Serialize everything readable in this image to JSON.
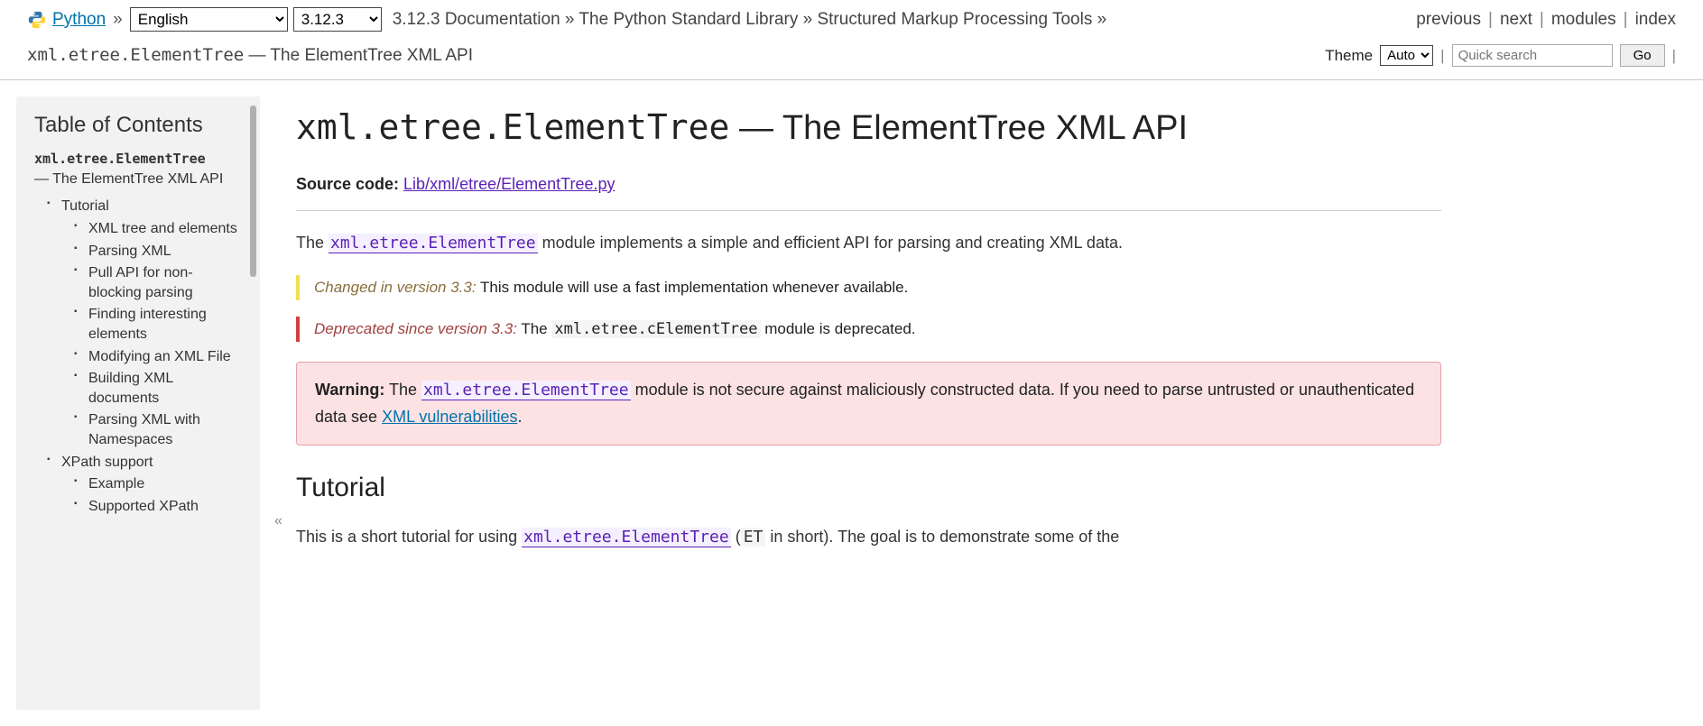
{
  "topbar": {
    "python": "Python",
    "lang": "English",
    "version": "3.12.3",
    "crumb1": "3.12.3 Documentation",
    "crumb2": "The Python Standard Library",
    "crumb3": "Structured Markup Processing Tools",
    "prev": "previous",
    "next": "next",
    "modules": "modules",
    "index": "index"
  },
  "subbar": {
    "mono": "xml.etree.ElementTree",
    "rest": " — The ElementTree XML API",
    "theme_label": "Theme",
    "theme_value": "Auto",
    "search_placeholder": "Quick search",
    "go": "Go"
  },
  "toc": {
    "title": "Table of Contents",
    "root_mono": "xml.etree.ElementTree",
    "root_rest": "— The ElementTree XML API",
    "items": {
      "tutorial": "Tutorial",
      "xmltree": "XML tree and elements",
      "parsing": "Parsing XML",
      "pullapi": "Pull API for non-blocking parsing",
      "finding": "Finding interesting elements",
      "modifying": "Modifying an XML File",
      "building": "Building XML documents",
      "namespaces": "Parsing XML with Namespaces",
      "xpath": "XPath support",
      "example": "Example",
      "supported": "Supported XPath"
    }
  },
  "content": {
    "h1_mono": "xml.etree.ElementTree",
    "h1_rest": " — The ElementTree XML API",
    "source_label": "Source code:",
    "source_link": "Lib/xml/etree/ElementTree.py",
    "intro_pre": "The ",
    "intro_mod": "xml.etree.ElementTree",
    "intro_post": " module implements a simple and efficient API for parsing and creating XML data.",
    "changed_label": "Changed in version 3.3:",
    "changed_text": " This module will use a fast implementation whenever available.",
    "deprecated_label": "Deprecated since version 3.3:",
    "deprecated_pre": " The ",
    "deprecated_mod": "xml.etree.cElementTree",
    "deprecated_post": " module is deprecated.",
    "warning_label": "Warning:",
    "warning_pre": "   The ",
    "warning_mod": "xml.etree.ElementTree",
    "warning_mid": " module is not secure against maliciously constructed data. If you need to parse untrusted or unauthenticated data see ",
    "warning_link": "XML vulnerabilities",
    "warning_post": ".",
    "h2_tutorial": "Tutorial",
    "tut_pre": "This is a short tutorial for using ",
    "tut_mod": "xml.etree.ElementTree",
    "tut_mid": " (",
    "tut_et": "ET",
    "tut_post": " in short). The goal is to demonstrate some of the"
  }
}
